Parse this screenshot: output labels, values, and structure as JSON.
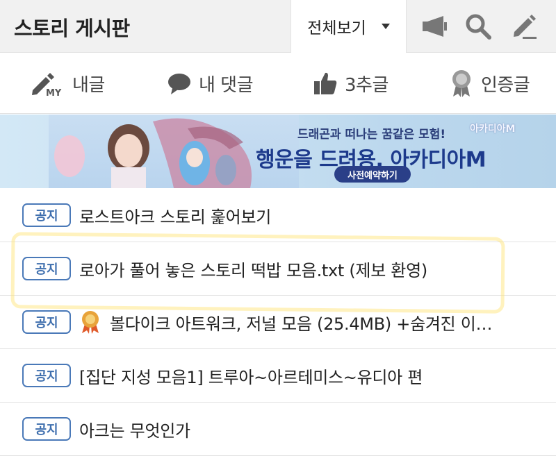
{
  "header": {
    "title": "스토리 게시판",
    "view_select": "전체보기",
    "icons": [
      "megaphone-icon",
      "search-icon",
      "pencil-icon"
    ]
  },
  "filters": [
    {
      "label": "내글",
      "icon": "my-pencil-icon"
    },
    {
      "label": "내 댓글",
      "icon": "speech-bubble-icon"
    },
    {
      "label": "3추글",
      "icon": "thumbs-up-icon"
    },
    {
      "label": "인증글",
      "icon": "certified-medal-icon"
    }
  ],
  "banner": {
    "line1": "드래곤과 떠나는 꿈같은 모험!",
    "line2": "행운을 드려용, 아카디아M",
    "button": "사전예약하기",
    "brand": "아카디아M"
  },
  "posts": [
    {
      "badge": "공지",
      "title": "로스트아크 스토리 훑어보기"
    },
    {
      "badge": "공지",
      "title": "로아가 풀어 놓은 스토리 떡밥 모음.txt (제보 환영)"
    },
    {
      "badge": "공지",
      "title": "볼다이크 아트워크, 저널 모음 (25.4MB) +숨겨진 이…",
      "medal": true
    },
    {
      "badge": "공지",
      "title": "[집단 지성 모음1] 트루아~아르테미스~유디아 편"
    },
    {
      "badge": "공지",
      "title": "아크는 무엇인가"
    }
  ],
  "colors": {
    "badge_border": "#4a79b8",
    "header_bg": "#f1f1f1",
    "highlight": "#ffe26e"
  }
}
